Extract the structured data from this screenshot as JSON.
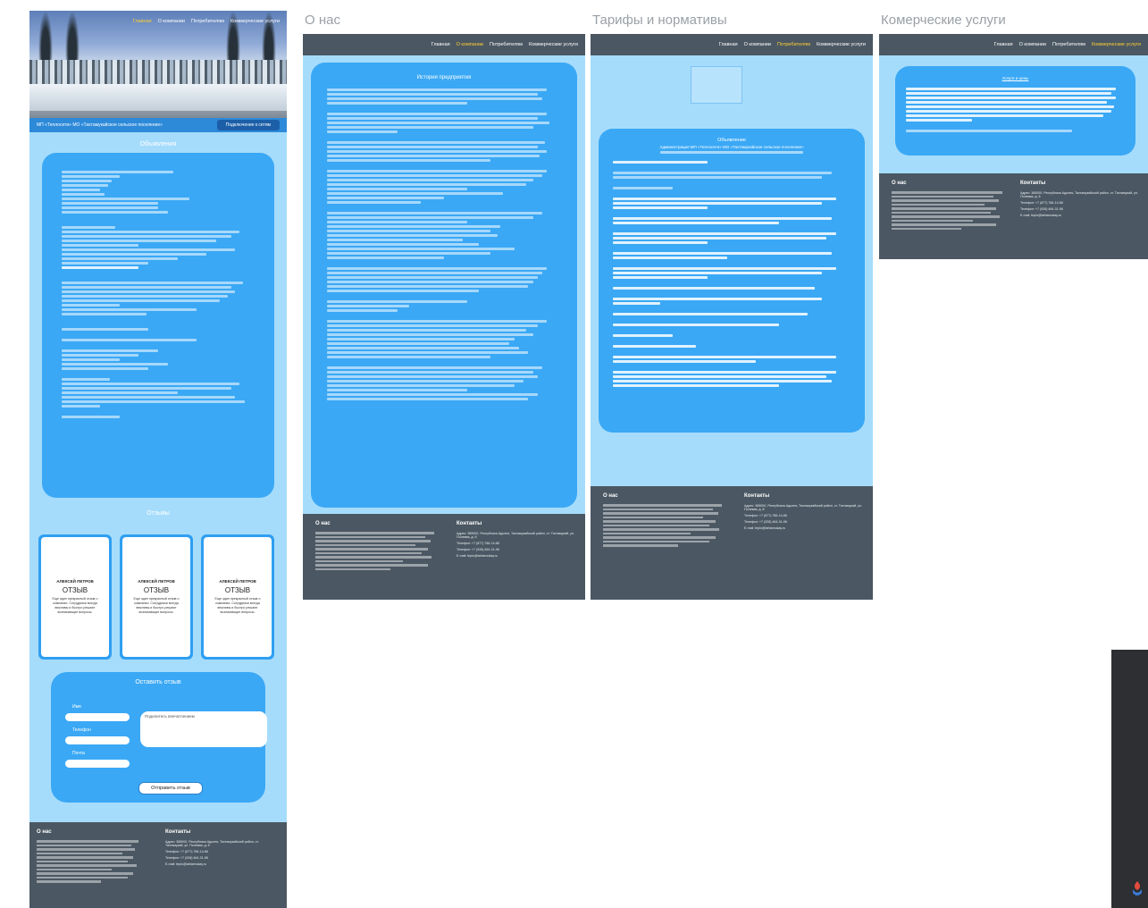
{
  "nav": {
    "home": "Главная",
    "about": "О компании",
    "consumers": "Потребителям",
    "commercial": "Коммерческие услуги"
  },
  "frame_titles": {
    "about": "О нас",
    "tariffs": "Тарифы и нормативы",
    "commercial": "Комерческие услуги"
  },
  "home": {
    "hero_company": "МП «Теплосети» МО «Тахтамукайское сельское поселение»",
    "hero_button": "Подключение к сетям",
    "announcements_title": "Объявления",
    "reviews_title": "Отзывы",
    "reviews": [
      {
        "name": "АЛЕКСЕЙ ПЕТРОВ",
        "title": "ОТЗЫВ",
        "text": "Еще один прекрасный отзыв о компании. Сотрудники всегда вежливы и быстро решают возникающие вопросы."
      },
      {
        "name": "АЛЕКСЕЙ ПЕТРОВ",
        "title": "ОТЗЫВ",
        "text": "Еще один прекрасный отзыв о компании. Сотрудники всегда вежливы и быстро решают возникающие вопросы."
      },
      {
        "name": "АЛЕКСЕЙ ПЕТРОВ",
        "title": "ОТЗЫВ",
        "text": "Еще один прекрасный отзыв о компании. Сотрудники всегда вежливы и быстро решают возникающие вопросы."
      }
    ],
    "feedback_title": "Оставить отзыв",
    "field_name": "Имя",
    "field_phone": "Телефон",
    "field_email": "Почта",
    "textarea_placeholder": "Поделитесь впечатлением",
    "send_button": "Отправить отзыв"
  },
  "about": {
    "history_title": "История предприятия"
  },
  "tariffs": {
    "announcement_title": "Объявление",
    "announcement_subtitle": "Администрация МП «Теплосети» МО «Тахтамукайское сельское поселение»"
  },
  "commercial": {
    "services_title": "Услуги и цены"
  },
  "footer": {
    "about_heading": "О нас",
    "contacts_heading": "Контакты",
    "address": "Адрес: 385000, Республика Адыгея, Тахтамукайский район, ст. Тахтамукай, ул. Полевая, д. 8",
    "phone1": "Телефон: +7 (877) 786-14-88",
    "phone2": "Телефон: +7 (928) 464-31-98",
    "email": "E-mail: teplo@tahtamukay.ru"
  },
  "colors": {
    "page_bg": "#a6dcfb",
    "card": "#3aa8f5",
    "nav": "#4b5863",
    "accent": "#ffcf33"
  }
}
